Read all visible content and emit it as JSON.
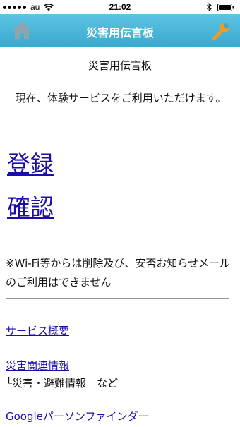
{
  "status_bar": {
    "carrier": "au",
    "time": "21:02"
  },
  "nav": {
    "title": "災害用伝言板",
    "left_icon": "home-icon",
    "right_icon": "wrench-icon",
    "bar_color": "#3aa9cf",
    "wrench_color": "#f29a22"
  },
  "main": {
    "heading": "災害用伝言板",
    "notice": "現在、体験サービスをご利用いただけます。",
    "register_link": "登録",
    "confirm_link": "確認",
    "wifi_note": "※Wi-Fi等からは削除及び、安否お知らせメールのご利用はできません",
    "links": {
      "service_overview": "サービス概要",
      "disaster_info": "災害関連情報",
      "disaster_info_sub": "└災害・避難情報　など",
      "google_finder": "Googleパーソンファインダー"
    },
    "link_color": "#1a0dab"
  }
}
